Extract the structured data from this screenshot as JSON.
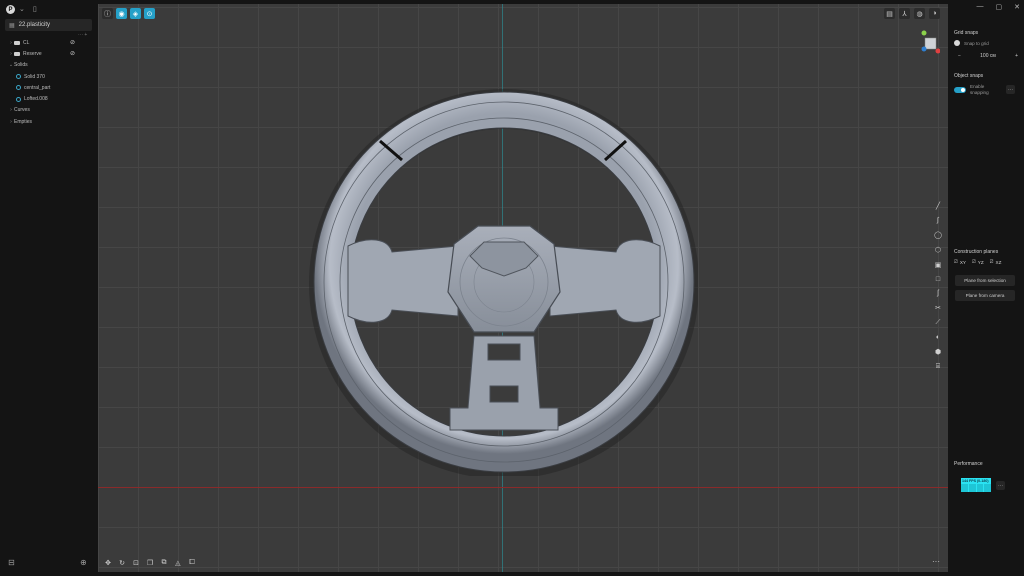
{
  "app": {
    "logo_letter": "P"
  },
  "file": {
    "name": "22.plasticity"
  },
  "tree": [
    {
      "kind": "group",
      "label": "CL"
    },
    {
      "kind": "group",
      "label": "Reserve"
    },
    {
      "kind": "section",
      "label": "Solids"
    },
    {
      "kind": "solid",
      "label": "Solid 370"
    },
    {
      "kind": "solid",
      "label": "central_part"
    },
    {
      "kind": "solid",
      "label": "Lofted.008"
    },
    {
      "kind": "section",
      "label": "Curves"
    },
    {
      "kind": "section",
      "label": "Empties"
    }
  ],
  "grid_snaps": {
    "title": "Grid snaps",
    "snap_label": "Snap to grid",
    "decrement": "−",
    "value": "100 см",
    "increment": "+"
  },
  "object_snaps": {
    "title": "Object snaps",
    "toggle_label": "Enable snapping",
    "more": "···"
  },
  "construction_planes": {
    "title": "Construction planes",
    "planes": [
      "XY",
      "YZ",
      "XZ"
    ],
    "from_selection": "Plane from selection",
    "from_camera": "Plane from camera"
  },
  "performance": {
    "title": "Performance",
    "fps": "144 FPS (0-180)",
    "more": "···"
  },
  "viewport": {
    "more": "···"
  },
  "colors": {
    "accent": "#25a0c8",
    "perf": "#2ae3f2",
    "axis_x": "#8a2a2a",
    "axis_y": "#2f7f86"
  },
  "icons": {
    "window": [
      "minimize-icon",
      "maximize-icon",
      "close-icon"
    ],
    "viewport_tools": [
      "line-icon",
      "curve-icon",
      "circle-icon",
      "polygon-icon",
      "box-icon",
      "rectangle-icon",
      "spiral-icon",
      "scissors-icon",
      "bridge-icon",
      "sphere-icon",
      "cube-icon",
      "cylinder-icon"
    ]
  }
}
